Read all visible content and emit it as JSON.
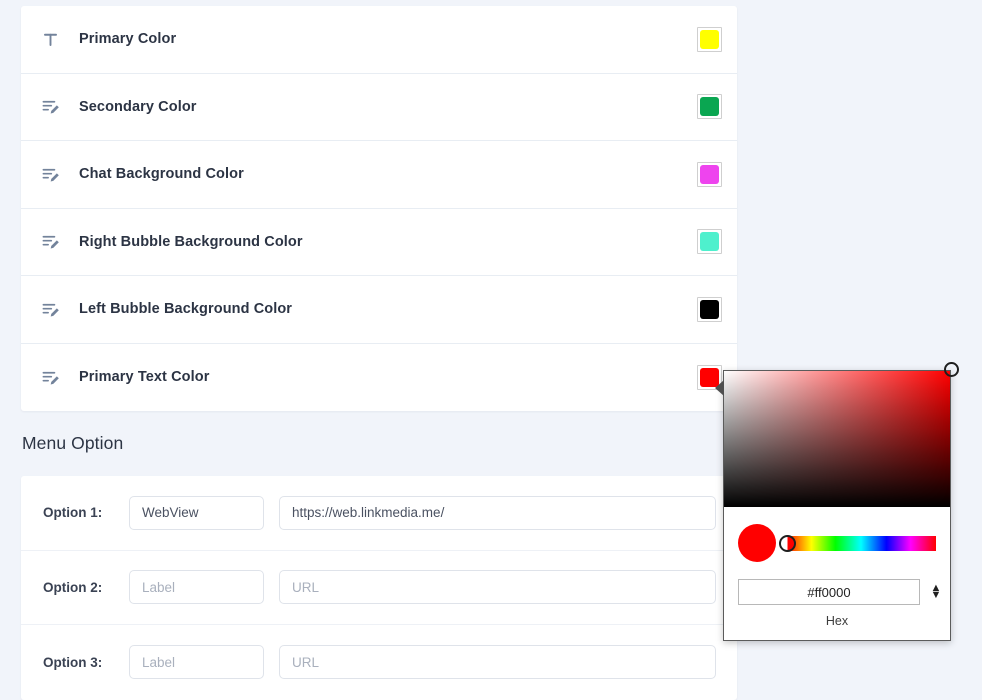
{
  "page": {
    "background_color": "#f1f4fa"
  },
  "color_settings": {
    "rows": [
      {
        "icon": "text-format-icon",
        "label": "Primary Color",
        "color": "#ffff00"
      },
      {
        "icon": "rename-edit-icon",
        "label": "Secondary Color",
        "color": "#0aa651"
      },
      {
        "icon": "rename-edit-icon",
        "label": "Chat Background Color",
        "color": "#ee44ee"
      },
      {
        "icon": "rename-edit-icon",
        "label": "Right Bubble Background Color",
        "color": "#4ef0cd"
      },
      {
        "icon": "rename-edit-icon",
        "label": "Left Bubble Background Color",
        "color": "#000000"
      },
      {
        "icon": "rename-edit-icon",
        "label": "Primary Text Color",
        "color": "#ff0000"
      }
    ]
  },
  "menu_option": {
    "title": "Menu Option",
    "options": [
      {
        "label": "Option 1:",
        "label_value": "WebView",
        "label_placeholder": "Label",
        "url_value": "https://web.linkmedia.me/",
        "url_placeholder": "URL"
      },
      {
        "label": "Option 2:",
        "label_value": "",
        "label_placeholder": "Label",
        "url_value": "",
        "url_placeholder": "URL"
      },
      {
        "label": "Option 3:",
        "label_value": "",
        "label_placeholder": "Label",
        "url_value": "",
        "url_placeholder": "URL"
      }
    ]
  },
  "color_picker": {
    "current_color": "#ff0000",
    "hue_color": "#ff0000",
    "hex_value": "#ff0000",
    "hex_caption": "Hex",
    "stepper_up": "▲",
    "stepper_down": "▼"
  }
}
